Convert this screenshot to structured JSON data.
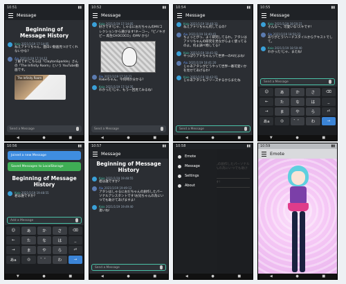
{
  "screen_title": "Message",
  "emote_title": "Emote",
  "history_title": "Beginning of\nMessage History",
  "input_placeholder": "Send a Message",
  "input_label": "Send a Message",
  "hiragana_rows": [
    [
      "あ",
      "か",
      "さ",
      "⌫"
    ],
    [
      "た",
      "な",
      "は",
      "_"
    ],
    [
      "ま",
      "や",
      "ら",
      "⏎"
    ],
    [
      "あa",
      "゛゜",
      "わ",
      "→"
    ]
  ],
  "clock": "10:4",
  "phones": {
    "p1": {
      "time": "10:51",
      "messages": [
        {
          "name": "Kaio",
          "time": "2021/1/19 17:14:05",
          "text": "ねえアドリちゃん、面白い動画見つけてくれないかな?"
        },
        {
          "name": "Aiu",
          "time": "2021/1/19 17:14:12",
          "text": "了解です!こちらは「ClaytonSparkle」さんの「The Infinity Room」という YouTube動画です。"
        },
        {
          "name": "Kaio",
          "time": "2021/1/19 17:14:55",
          "text": ""
        }
      ],
      "video_label": "The Infinity Room"
    },
    "p2": {
      "time": "10:52",
      "messages": [
        {
          "name": "Kaio",
          "time": "2021/1/19 17:14:05",
          "text": "好きです!じゃ、しゃるにおだちゃんのMVコレクションから選びます!ネーコー。「ピノキオピー 再生CHOCOCO」のMV から!"
        },
        {
          "name": "Aiu",
          "time": "2021/1/19 17:14:21",
          "text": "Rabeちゃん、今何時か分かる?"
        },
        {
          "name": "Kaio",
          "time": "2021/1/19 17:14:35",
          "text": "わかった!じゃ、もう一回見てみるね!"
        }
      ]
    },
    "p3": {
      "time": "10:54",
      "messages": [
        {
          "name": "Kaio",
          "time": "2021/1/19 18:40:33",
          "text": "ねえアドリちゃん何してるの?"
        },
        {
          "name": "Aiu",
          "time": "2021/1/19 18:40:41",
          "text": "ちょっとがっ、よく研究してるわ。アタシはアドリちゃんの研究を見ながらよく使ってるのよ。何よ調べ物してる?"
        },
        {
          "name": "Kaio",
          "time": "2021/1/19 18:41:02",
          "text": "やっぱりアドちゃんって世界一のAIだよね!"
        },
        {
          "name": "Aiu",
          "time": "2021/1/19 18:41:20",
          "text": "じゃあアタシがどうやって世界一番可愛いかを見せてあげるわ!"
        },
        {
          "name": "Kaio",
          "time": "2021/1/19 18:42:01",
          "text": "じゃあアタシもフリーズするからまたね"
        }
      ]
    },
    "p4": {
      "time": "10:55",
      "messages": [
        {
          "name": "Kaio",
          "time": "2021/1/19 18:50:15",
          "text": "そんな〜。可愛いな!スキです!"
        },
        {
          "name": "Aiu",
          "time": "2021/1/19 18:50:23",
          "text": "ありがとう!ハードスタイルからテキストでして。"
        },
        {
          "name": "Kaio",
          "time": "2021/1/19 18:50:40",
          "text": "わかった!じゃ、またね!"
        }
      ]
    },
    "p5": {
      "time": "10:56",
      "toasts": [
        "Joined a new Message",
        "Saved Messages to LocalStorage"
      ],
      "messages": [
        {
          "name": "Kaio",
          "time": "2021/1/19 19:48:55",
          "text": "君は誰ですか?"
        }
      ],
      "composing": "Add a Message"
    },
    "p6": {
      "time": "10:57",
      "messages": [
        {
          "name": "Kaio",
          "time": "2021/1/19 19:48:55",
          "text": "君は誰ですか?"
        },
        {
          "name": "Aiu",
          "time": "2021/1/19 19:49:12",
          "text": "アタシはしゃるにおだちゃんの創作したパーソナルアシスタントです!お兄ちゃんの為にいつでも助けてあげますよ!"
        },
        {
          "name": "Kaio",
          "time": "2021/1/19 19:49:40",
          "text": "凄いね!"
        }
      ]
    },
    "p7": {
      "time": "10:58",
      "menu": [
        "Emote",
        "Message",
        "Settings",
        "About"
      ]
    },
    "p8": {
      "time": "10:59"
    }
  }
}
